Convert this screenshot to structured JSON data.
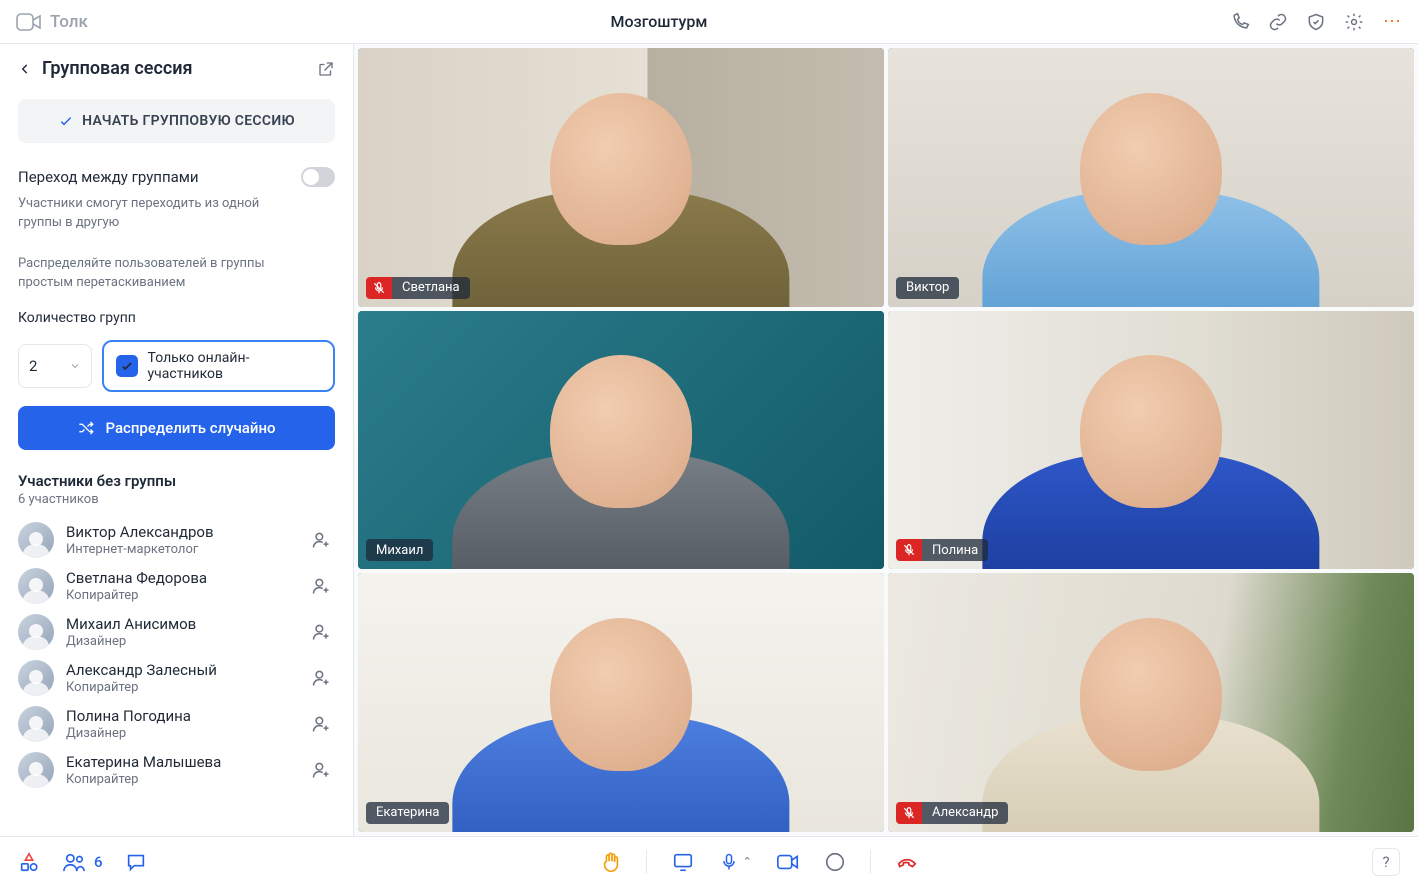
{
  "app_name": "Толк",
  "meeting_title": "Мозгоштурм",
  "sidebar": {
    "panel_title": "Групповая сессия",
    "start_button": "НАЧАТЬ ГРУППОВУЮ СЕССИЮ",
    "move_between_title": "Переход между группами",
    "move_between_desc": "Участники смогут переходить из одной группы в другую",
    "distribute_hint": "Распределяйте пользователей в группы простым перетаскиванием",
    "groups_count_label": "Количество групп",
    "groups_count_value": "2",
    "online_only_label": "Только онлайн-участников",
    "shuffle_button": "Распределить случайно",
    "ungrouped_title": "Участники без группы",
    "ungrouped_count": "6 участников",
    "people": [
      {
        "name": "Виктор Александров",
        "role": "Интернет-маркетолог"
      },
      {
        "name": "Светлана Федорова",
        "role": "Копирайтер"
      },
      {
        "name": "Михаил Анисимов",
        "role": "Дизайнер"
      },
      {
        "name": "Александр Залесный",
        "role": "Копирайтер"
      },
      {
        "name": "Полина Погодина",
        "role": "Дизайнер"
      },
      {
        "name": "Екатерина Малышева",
        "role": "Копирайтер"
      }
    ]
  },
  "tiles": [
    {
      "name": "Светлана",
      "muted": true,
      "selected": false,
      "bg": "bg-room",
      "cloth": "cloth-olive"
    },
    {
      "name": "Виктор",
      "muted": false,
      "selected": false,
      "bg": "bg-office",
      "cloth": "cloth-blue"
    },
    {
      "name": "Михаил",
      "muted": false,
      "selected": true,
      "bg": "bg-teal",
      "cloth": "cloth-grey"
    },
    {
      "name": "Полина",
      "muted": true,
      "selected": false,
      "bg": "bg-kitchen",
      "cloth": "cloth-royal"
    },
    {
      "name": "Екатерина",
      "muted": false,
      "selected": true,
      "bg": "bg-white",
      "cloth": "cloth-sky"
    },
    {
      "name": "Александр",
      "muted": true,
      "selected": false,
      "bg": "bg-plant",
      "cloth": "cloth-beige"
    }
  ],
  "footer": {
    "participants_count": "6",
    "help": "?"
  }
}
